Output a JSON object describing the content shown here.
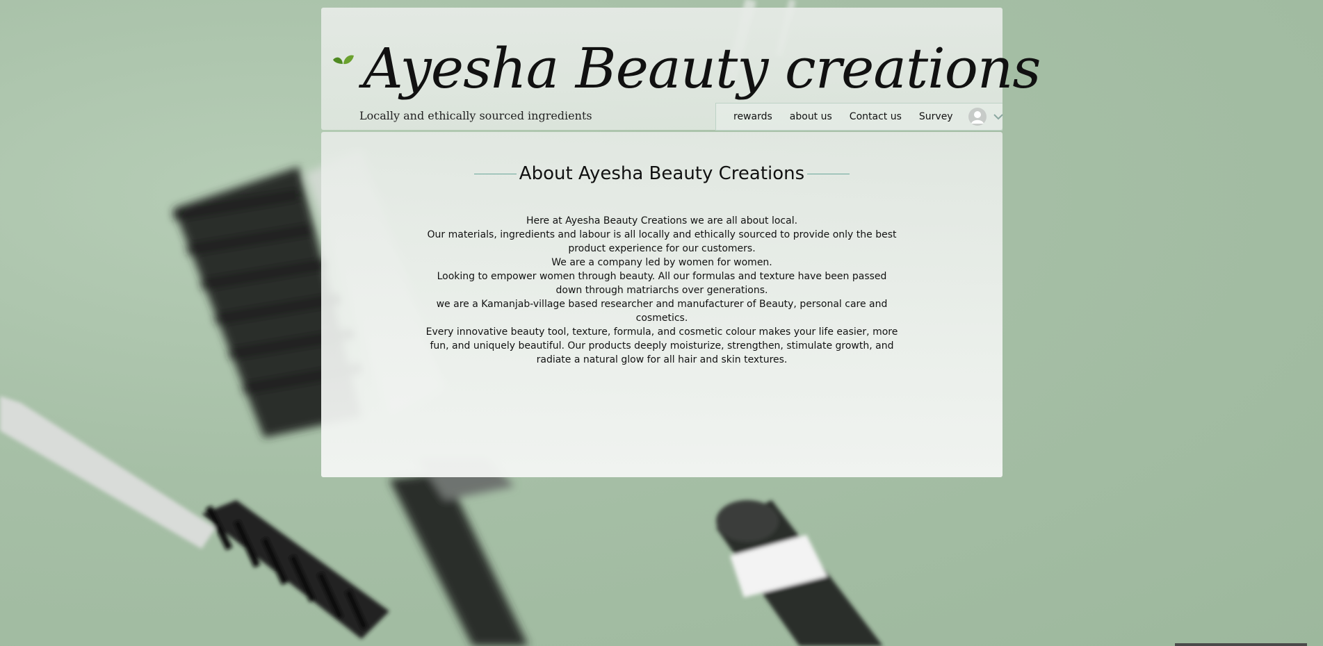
{
  "site": {
    "title": "Ayesha Beauty creations",
    "tagline": "Locally and ethically sourced ingredients",
    "logo_icon": "leaf-icon"
  },
  "nav": {
    "items": [
      {
        "label": "rewards"
      },
      {
        "label": "about us"
      },
      {
        "label": "Contact us"
      },
      {
        "label": "Survey"
      }
    ],
    "account_icon": "avatar-icon",
    "dropdown_icon": "chevron-down-icon"
  },
  "about": {
    "heading": "About Ayesha Beauty Creations",
    "paragraphs": [
      "Here at  Ayesha Beauty Creations we are all about local.",
      "Our materials, ingredients and labour is all locally and ethically sourced to provide only the best product experience for our customers.",
      "We are a company led by women for women.",
      "Looking to empower women through beauty. All our formulas and texture have been passed down through matriarchs over generations.",
      "we are a Kamanjab-village based researcher and manufacturer of Beauty, personal care and cosmetics.",
      "Every innovative beauty tool, texture, formula, and cosmetic colour makes your life easier, more fun, and uniquely beautiful. Our products deeply moisturize, strengthen, stimulate growth, and radiate a natural glow for all hair and skin textures."
    ]
  },
  "colors": {
    "background": "#a9c2a9",
    "accent_line": "#6aa79a",
    "leaf_green": "#5a8f2a"
  }
}
